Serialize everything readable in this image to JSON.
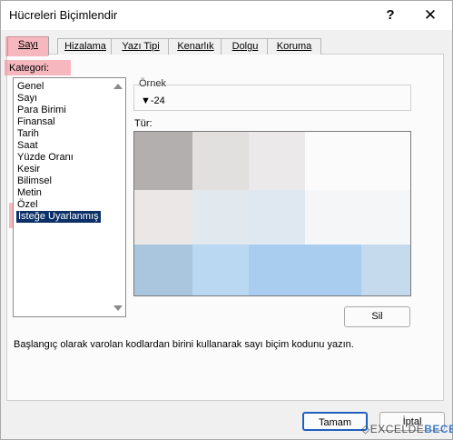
{
  "window": {
    "title": "Hücreleri Biçimlendir",
    "help": "?",
    "close": "✕"
  },
  "tabs": [
    "Sayı",
    "Hizalama",
    "Yazı Tipi",
    "Kenarlık",
    "Dolgu",
    "Koruma"
  ],
  "active_tab": "Sayı",
  "category": {
    "label": "Kategori:",
    "items": [
      "Genel",
      "Sayı",
      "Para Birimi",
      "Finansal",
      "Tarih",
      "Saat",
      "Yüzde Oranı",
      "Kesir",
      "Bilimsel",
      "Metin",
      "Özel",
      "İsteğe Uyarlanmış"
    ],
    "selected": "İsteğe Uyarlanmış"
  },
  "sample": {
    "label": "Örnek",
    "value": "▼-24"
  },
  "type_label": "Tür:",
  "delete_button": "Sil",
  "description": "Başlangıç olarak varolan kodlardan birini kullanarak sayı biçim kodunu yazın.",
  "ok_button": "Tamam",
  "cancel_button": "İptal",
  "watermark": {
    "part1": "EXCELDE",
    "part2": "BECE"
  },
  "colors": {
    "highlight": "#f2808c",
    "selection": "#0b2f66",
    "accent": "#1f5fbf"
  }
}
